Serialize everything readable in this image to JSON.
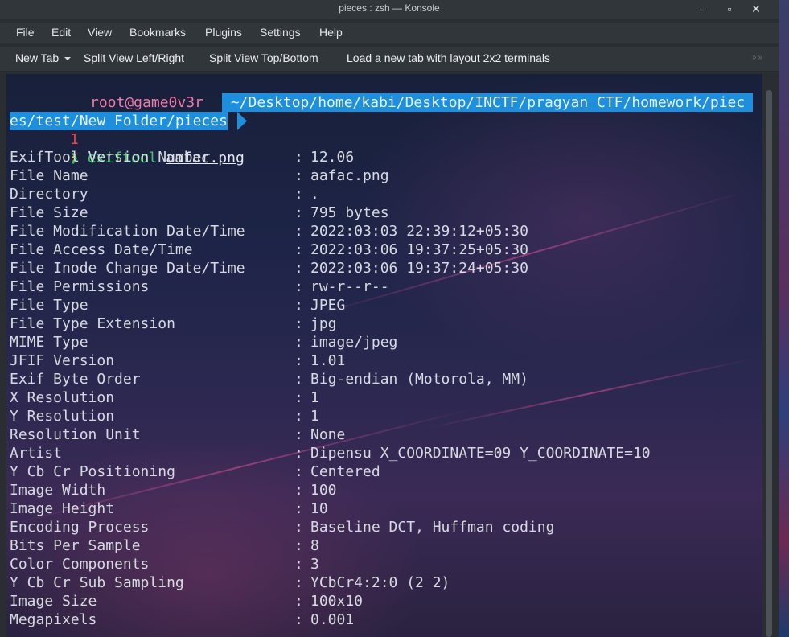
{
  "window": {
    "title": "pieces : zsh — Konsole",
    "controls": {
      "minimize": "‒",
      "maximize": "▫",
      "close": "✕"
    }
  },
  "menu": [
    "File",
    "Edit",
    "View",
    "Bookmarks",
    "Plugins",
    "Settings",
    "Help"
  ],
  "toolbar": {
    "new_tab": "New Tab",
    "split_left_right": "Split View Left/Right",
    "split_top_bottom": "Split View Top/Bottom",
    "layout_2x2": "Load a new tab with layout 2x2 terminals",
    "overflow": "»»"
  },
  "prompt": {
    "status_mark": "✘",
    "exit_code": "1",
    "bolt": "⚡",
    "user_host": "root@game0v3r",
    "path_line1": " ~/Desktop/home/kabi/Desktop/INCTF/pragyan CTF/homework/piec",
    "path_line2": "es/test/New Folder/pieces",
    "command_arrow": "❯",
    "command": "exiftool",
    "argument": "aafac.png"
  },
  "exif_rows": [
    {
      "key": "ExifTool Version Number",
      "value": "12.06"
    },
    {
      "key": "File Name",
      "value": "aafac.png"
    },
    {
      "key": "Directory",
      "value": "."
    },
    {
      "key": "File Size",
      "value": "795 bytes"
    },
    {
      "key": "File Modification Date/Time",
      "value": "2022:03:03 22:39:12+05:30"
    },
    {
      "key": "File Access Date/Time",
      "value": "2022:03:06 19:37:25+05:30"
    },
    {
      "key": "File Inode Change Date/Time",
      "value": "2022:03:06 19:37:24+05:30"
    },
    {
      "key": "File Permissions",
      "value": "rw-r--r--"
    },
    {
      "key": "File Type",
      "value": "JPEG"
    },
    {
      "key": "File Type Extension",
      "value": "jpg"
    },
    {
      "key": "MIME Type",
      "value": "image/jpeg"
    },
    {
      "key": "JFIF Version",
      "value": "1.01"
    },
    {
      "key": "Exif Byte Order",
      "value": "Big-endian (Motorola, MM)"
    },
    {
      "key": "X Resolution",
      "value": "1"
    },
    {
      "key": "Y Resolution",
      "value": "1"
    },
    {
      "key": "Resolution Unit",
      "value": "None"
    },
    {
      "key": "Artist",
      "value": "Dipensu X_COORDINATE=09 Y_COORDINATE=10"
    },
    {
      "key": "Y Cb Cr Positioning",
      "value": "Centered"
    },
    {
      "key": "Image Width",
      "value": "100"
    },
    {
      "key": "Image Height",
      "value": "10"
    },
    {
      "key": "Encoding Process",
      "value": "Baseline DCT, Huffman coding"
    },
    {
      "key": "Bits Per Sample",
      "value": "8"
    },
    {
      "key": "Color Components",
      "value": "3"
    },
    {
      "key": "Y Cb Cr Sub Sampling",
      "value": "YCbCr4:2:0 (2 2)"
    },
    {
      "key": "Image Size",
      "value": "100x10"
    },
    {
      "key": "Megapixels",
      "value": "0.001"
    }
  ],
  "row_separator": ":",
  "colors": {
    "path_segment": "#1e8fdc",
    "error_mark": "#ff3b3b",
    "user_host": "#f27aa5",
    "command": "#3ec96e"
  }
}
